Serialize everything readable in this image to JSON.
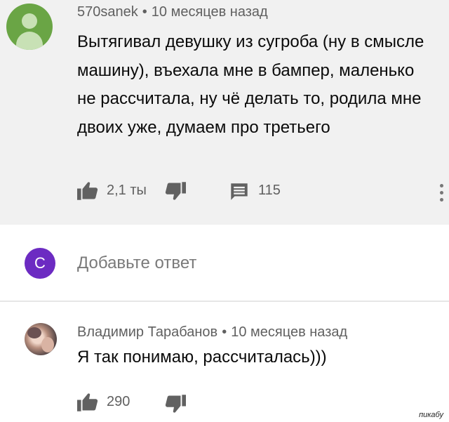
{
  "comment1": {
    "author": "570sanek",
    "separator": "•",
    "time": "10 месяцев назад",
    "text": "Вытягивал девушку из сугроба (ну в смысле машину), въехала мне в бампер, маленько не рассчитала, ну чё делать то, родила мне двоих уже, думаем про третьего",
    "likes": "2,1 ты",
    "replies": "115"
  },
  "reply_box": {
    "avatar_letter": "С",
    "placeholder": "Добавьте ответ",
    "avatar_color": "#6c2bc2"
  },
  "comment2": {
    "author": "Владимир Тарабанов",
    "separator": "•",
    "time": "10 месяцев назад",
    "text": "Я так понимаю, рассчиталась)))",
    "likes": "290"
  },
  "watermark": "пикабу",
  "icons": {
    "like": "thumbs-up-icon",
    "dislike": "thumbs-down-icon",
    "reply": "comment-icon",
    "menu": "more-vert-icon"
  }
}
